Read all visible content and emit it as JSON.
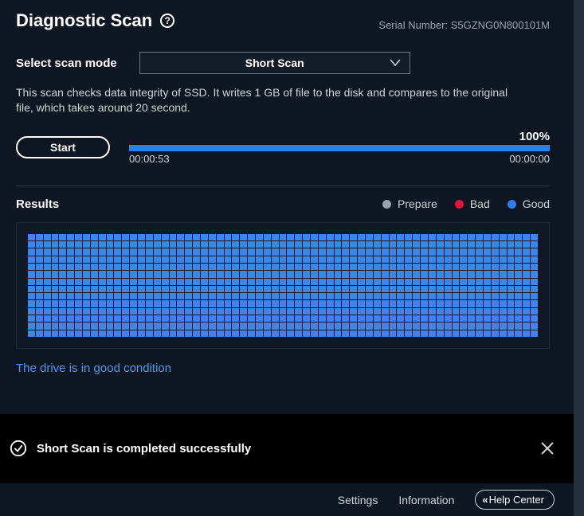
{
  "header": {
    "title": "Diagnostic Scan",
    "serial_label": "Serial Number: ",
    "serial_value": "S5GZNG0N800101M"
  },
  "scan_mode": {
    "label": "Select scan mode",
    "selected": "Short Scan"
  },
  "description": "This scan checks data integrity of SSD. It writes 1 GB of file to the disk and compares to the original file, which takes around 20 second.",
  "start_button": "Start",
  "progress": {
    "percent": "100%",
    "elapsed": "00:00:53",
    "remaining": "00:00:00"
  },
  "results": {
    "label": "Results",
    "legend": {
      "prepare": "Prepare",
      "bad": "Bad",
      "good": "Good"
    }
  },
  "condition_text": "The drive is in good condition",
  "toast": {
    "message": "Short Scan is completed successfully"
  },
  "footer": {
    "settings": "Settings",
    "information": "Information",
    "help_center": "Help Center"
  }
}
